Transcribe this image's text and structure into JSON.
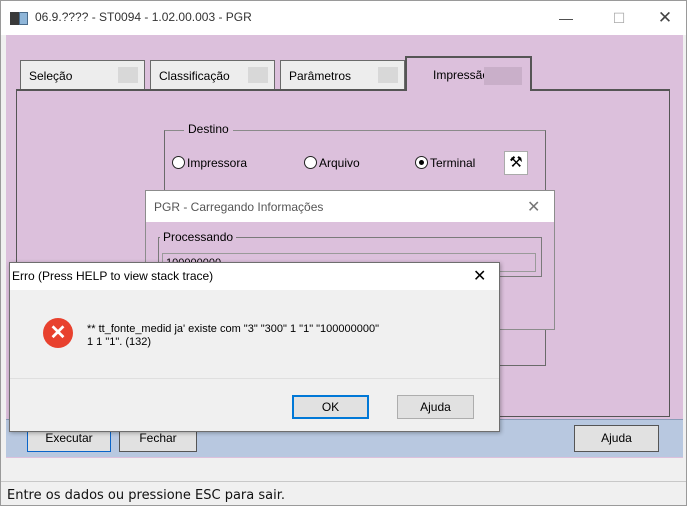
{
  "window": {
    "title": "06.9.???? - ST0094 - 1.02.00.003 - PGR",
    "controls": {
      "minimize": "—",
      "maximize": "☐",
      "close": "✕"
    }
  },
  "tabs": [
    {
      "label": "Seleção"
    },
    {
      "label": "Classificação"
    },
    {
      "label": "Parâmetros"
    },
    {
      "label": "Impressão",
      "selected": true
    }
  ],
  "destino": {
    "legend": "Destino",
    "options": [
      {
        "label": "Impressora",
        "checked": false
      },
      {
        "label": "Arquivo",
        "checked": false
      },
      {
        "label": "Terminal",
        "checked": true
      }
    ],
    "config_icon": "printer-setup-icon"
  },
  "footer": {
    "executar": "Executar",
    "fechar": "Fechar",
    "ajuda": "Ajuda"
  },
  "status_bar": "Entre os dados ou pressione ESC para sair.",
  "loading_dialog": {
    "title": "PGR - Carregando Informações",
    "close": "✕",
    "group_label": "Processando",
    "field_value": "100000000"
  },
  "error_dialog": {
    "title": "Erro (Press HELP to view stack trace)",
    "close": "✕",
    "icon": "error-icon",
    "message_line1": "** tt_fonte_medid ja' existe com  \"3\"  \"300\"  1  \"1\"  \"100000000\"",
    "message_line2": "1  1  \"1\". (132)",
    "ok": "OK",
    "ajuda": "Ajuda"
  },
  "colors": {
    "client_bg": "#dcc0dc",
    "footer_strip": "#b8c8e0",
    "error_icon": "#e8412e",
    "focus_blue": "#0078d7"
  }
}
